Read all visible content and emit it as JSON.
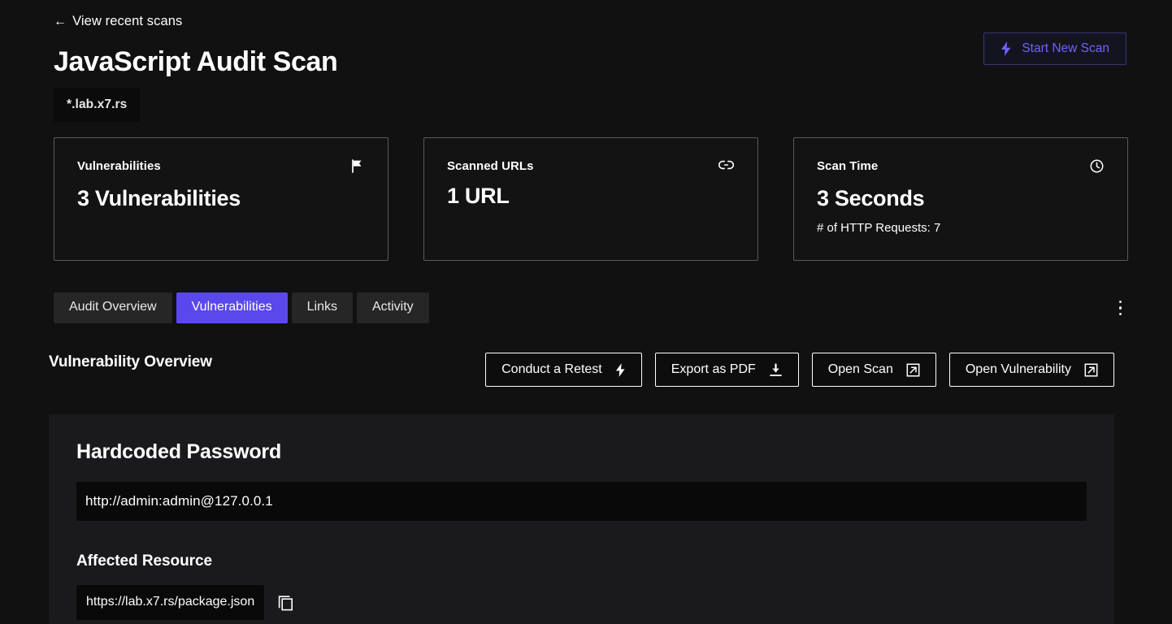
{
  "header": {
    "back_link": "View recent scans",
    "back_arrow": "←",
    "title": "JavaScript Audit Scan",
    "domain_badge": "*.lab.x7.rs",
    "start_scan_label": "Start New Scan",
    "start_scan_icon": "lightning-bolt-icon",
    "accent_color": "#6f63f5"
  },
  "cards": [
    {
      "label": "Vulnerabilities",
      "value": "3 Vulnerabilities",
      "sub": "",
      "icon": "flag-icon"
    },
    {
      "label": "Scanned URLs",
      "value": "1 URL",
      "sub": "",
      "icon": "link-icon"
    },
    {
      "label": "Scan Time",
      "value": "3 Seconds",
      "sub": "# of HTTP Requests: 7",
      "icon": "clock-icon"
    }
  ],
  "tabs": [
    {
      "label": "Audit Overview",
      "active": false
    },
    {
      "label": "Vulnerabilities",
      "active": true
    },
    {
      "label": "Links",
      "active": false
    },
    {
      "label": "Activity",
      "active": false
    }
  ],
  "tab_active_color": "#5a48ed",
  "overflow_menu": "more-options-icon",
  "section": {
    "title": "Vulnerability Overview",
    "actions": [
      {
        "label": "Conduct a Retest",
        "icon": "lightning-bolt-icon"
      },
      {
        "label": "Export as PDF",
        "icon": "download-icon"
      },
      {
        "label": "Open Scan",
        "icon": "external-link-icon"
      },
      {
        "label": "Open Vulnerability",
        "icon": "external-link-icon"
      }
    ]
  },
  "vulnerability": {
    "title": "Hardcoded Password",
    "evidence": "http://admin:admin@127.0.0.1",
    "affected_resource_label": "Affected Resource",
    "affected_resource": "https://lab.x7.rs/package.json",
    "copy_icon": "copy-icon"
  }
}
